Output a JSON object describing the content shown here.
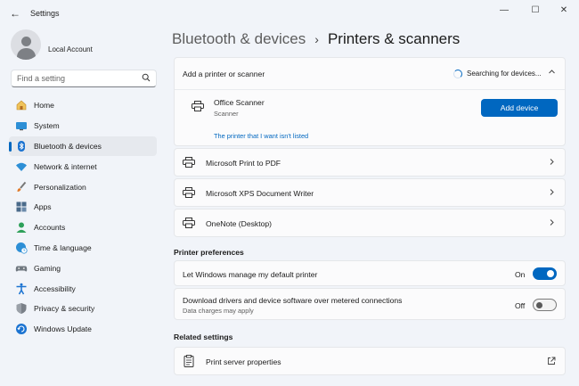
{
  "window": {
    "title": "Settings",
    "back_icon": "back-arrow-icon",
    "min_glyph": "—",
    "max_glyph": "☐",
    "close_glyph": "✕"
  },
  "profile": {
    "name": "Local Account"
  },
  "search": {
    "placeholder": "Find a setting",
    "icon": "search-icon"
  },
  "sidebar": {
    "items": [
      {
        "label": "Home",
        "icon": "home-icon"
      },
      {
        "label": "System",
        "icon": "system-icon"
      },
      {
        "label": "Bluetooth & devices",
        "icon": "bluetooth-icon",
        "active": true
      },
      {
        "label": "Network & internet",
        "icon": "wifi-icon"
      },
      {
        "label": "Personalization",
        "icon": "brush-icon"
      },
      {
        "label": "Apps",
        "icon": "apps-icon"
      },
      {
        "label": "Accounts",
        "icon": "accounts-icon"
      },
      {
        "label": "Time & language",
        "icon": "globe-clock-icon"
      },
      {
        "label": "Gaming",
        "icon": "gamepad-icon"
      },
      {
        "label": "Accessibility",
        "icon": "accessibility-icon"
      },
      {
        "label": "Privacy & security",
        "icon": "shield-icon"
      },
      {
        "label": "Windows Update",
        "icon": "update-icon"
      }
    ]
  },
  "breadcrumb": {
    "parent": "Bluetooth & devices",
    "separator": "›",
    "current": "Printers & scanners"
  },
  "add_printer": {
    "title": "Add a printer or scanner",
    "status": "Searching for devices...",
    "device_name": "Office Scanner",
    "device_type": "Scanner",
    "add_button": "Add device",
    "link": "The printer that I want isn't listed"
  },
  "printers": [
    {
      "name": "Microsoft Print to PDF"
    },
    {
      "name": "Microsoft XPS Document Writer"
    },
    {
      "name": "OneNote (Desktop)"
    }
  ],
  "preferences": {
    "title": "Printer preferences",
    "default_printer": {
      "label": "Let Windows manage my default printer",
      "state": "On",
      "on": true
    },
    "metered": {
      "label": "Download drivers and device software over metered connections",
      "sub": "Data charges may apply",
      "state": "Off",
      "on": false
    }
  },
  "related": {
    "title": "Related settings",
    "items": [
      {
        "label": "Print server properties",
        "icon": "external-link-icon"
      }
    ]
  },
  "colors": {
    "accent": "#0067c0",
    "background": "#f1f4f9",
    "card": "#fbfbfc"
  }
}
